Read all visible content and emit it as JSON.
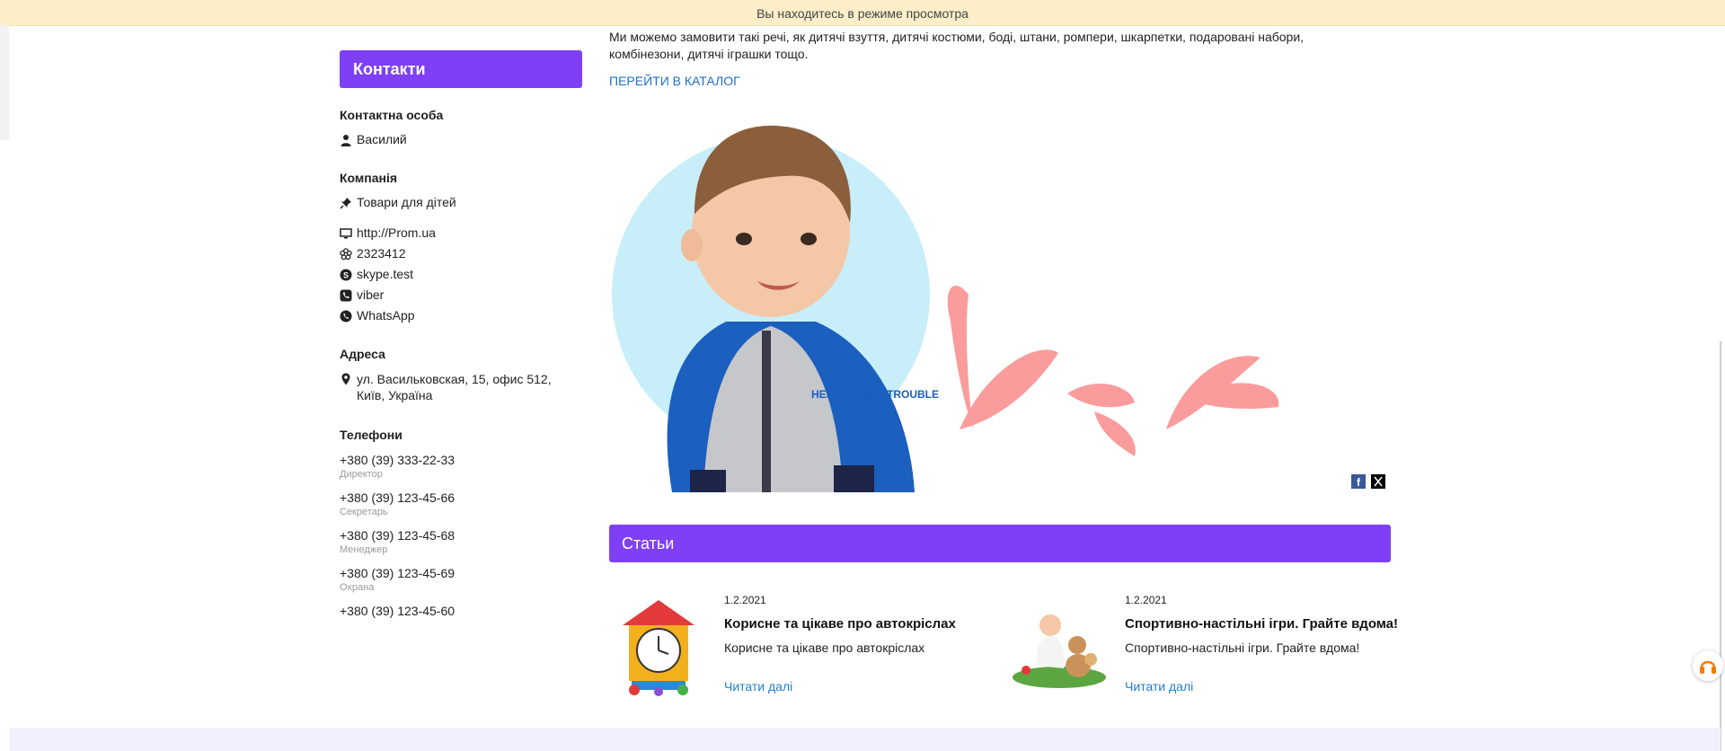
{
  "preview_bar": {
    "text": "Вы находитесь в режиме просмотра"
  },
  "sidebar": {
    "header": "Контакти",
    "contact_person_title": "Контактна особа",
    "contact_person": "Василий",
    "company_title": "Компанія",
    "company": "Товари для дітей",
    "links": [
      {
        "icon": "monitor-icon",
        "text": "http://Prom.ua"
      },
      {
        "icon": "icq-flower-icon",
        "text": "2323412"
      },
      {
        "icon": "skype-icon",
        "text": "skype.test"
      },
      {
        "icon": "viber-icon",
        "text": "viber"
      },
      {
        "icon": "whatsapp-icon",
        "text": "WhatsApp"
      }
    ],
    "address_title": "Адреса",
    "address": "ул. Васильковская, 15, офис 512, Київ, Україна",
    "phones_title": "Телефони",
    "phones": [
      {
        "number": "+380 (39) 333-22-33",
        "role": "Директор"
      },
      {
        "number": "+380 (39) 123-45-66",
        "role": "Секретарь"
      },
      {
        "number": "+380 (39) 123-45-68",
        "role": "Менеджер"
      },
      {
        "number": "+380 (39) 123-45-69",
        "role": "Охрана"
      },
      {
        "number": "+380 (39) 123-45-60",
        "role": ""
      }
    ]
  },
  "main": {
    "intro": "Ми можемо замовити такі речі, як дитячі взуття, дитячі костюми, боді, штани, ромпери, шкарпетки, подаровані набори, комбінезони, дитячі іграшки тощо.",
    "catalog_link": "ПЕРЕЙТИ В КАТАЛОГ",
    "hero_shirt_text": "HERE COMES TROUBLE",
    "articles_title": "Статьи",
    "articles": [
      {
        "date": "1.2.2021",
        "title": "Корисне та цікаве про автокріслах",
        "description": "Корисне та цікаве про автокріслах",
        "more": "Читати далі"
      },
      {
        "date": "1.2.2021",
        "title": "Спортивно-настільні ігри. Грайте вдома!",
        "description": "Спортивно-настільні ігри. Грайте вдома!",
        "more": "Читати далі"
      }
    ]
  },
  "colors": {
    "accent": "#7f3ff5",
    "link": "#1f6fc4",
    "preview_bar": "#fbeec9",
    "hero_circle": "#c8eefa",
    "hero_strokes": "#fb9c9c"
  }
}
